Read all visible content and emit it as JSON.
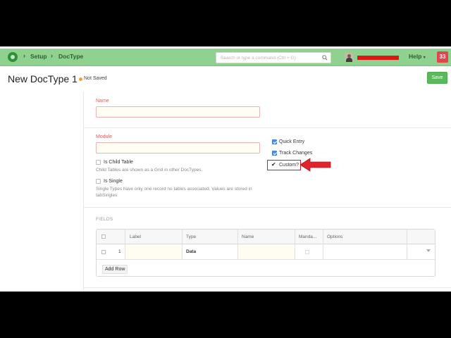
{
  "navbar": {
    "breadcrumbs": [
      "Setup",
      "DocType"
    ],
    "search_placeholder": "Search or type a command (Ctrl + G)",
    "help_label": "Help",
    "notifications_count": "33",
    "icons": [
      "app-logo-icon",
      "search-icon",
      "avatar",
      "chevron-down-icon"
    ]
  },
  "page": {
    "title": "New DocType 1",
    "status": "Not Saved",
    "save_label": "Save"
  },
  "form": {
    "name_label": "Name",
    "name_value": "",
    "module_label": "Module",
    "module_value": "",
    "is_child_table_label": "Is Child Table",
    "is_child_table_help": "Child Tables are shown as a Grid in other DocTypes.",
    "is_single_label": "Is Single",
    "is_single_help": "Single Types have only one record no tables associated. Values are stored in tabSingles",
    "quick_entry_label": "Quick Entry",
    "quick_entry_checked": true,
    "track_changes_label": "Track Changes",
    "track_changes_checked": true,
    "custom_label": "Custom?",
    "custom_checked": true
  },
  "fields": {
    "section_label": "FIELDS",
    "columns": [
      "Label",
      "Type",
      "Name",
      "Manda...",
      "Options"
    ],
    "rows": [
      {
        "idx": "1",
        "label": "",
        "type": "Data",
        "name": "",
        "options": ""
      }
    ],
    "add_row_label": "Add Row"
  },
  "colors": {
    "navbar": "#8fd18f",
    "save": "#5cb85c",
    "highlight": "#c8202a"
  }
}
